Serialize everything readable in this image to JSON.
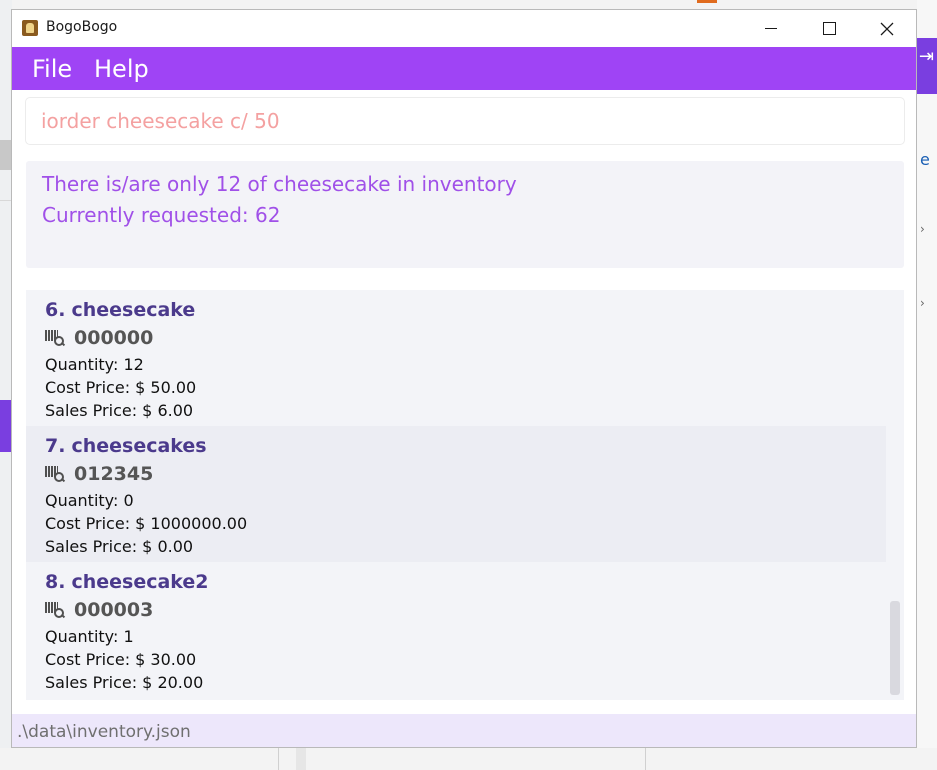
{
  "window": {
    "title": "BogoBogo"
  },
  "menu": {
    "file": "File",
    "help": "Help"
  },
  "command": {
    "value": "iorder cheesecake c/ 50"
  },
  "result": {
    "line1": "There is/are only 12 of cheesecake in inventory",
    "line2": "Currently requested: 62"
  },
  "items": [
    {
      "index": "6.",
      "name": "cheesecake",
      "id": "000000",
      "quantity": "Quantity: 12",
      "cost": "Cost Price: $ 50.00",
      "sales": "Sales Price: $ 6.00"
    },
    {
      "index": "7.",
      "name": "cheesecakes",
      "id": "012345",
      "quantity": "Quantity: 0",
      "cost": "Cost Price: $ 1000000.00",
      "sales": "Sales Price: $ 0.00"
    },
    {
      "index": "8.",
      "name": "cheesecake2",
      "id": "000003",
      "quantity": "Quantity: 1",
      "cost": "Cost Price: $ 30.00",
      "sales": "Sales Price: $ 20.00"
    }
  ],
  "status": {
    "path": ".\\data\\inventory.json"
  },
  "colors": {
    "menu_bar": "#9f44f5",
    "result_text": "#a050e8",
    "command_text": "#f4a1a1",
    "item_name": "#4b3a8c",
    "status_bar": "#ede7fb"
  },
  "icons": {
    "barcode": "barcode-search-icon",
    "app": "contact-book-icon"
  }
}
